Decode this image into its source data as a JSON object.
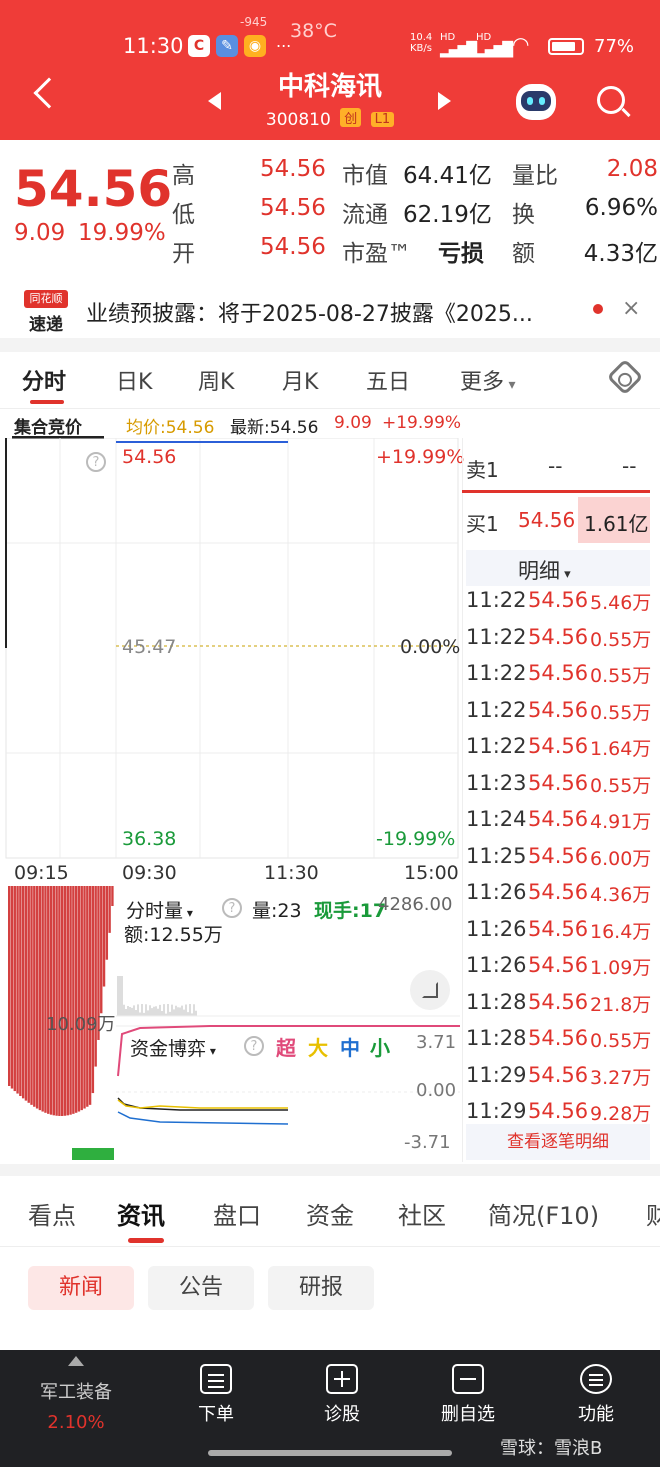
{
  "status_bar": {
    "time": "11:30",
    "temp": "38°C",
    "tiny_num": "-945",
    "more": "...",
    "net": "10.4\nKB/s",
    "net_label": "HD",
    "battery": "77%"
  },
  "header": {
    "title": "中科海讯",
    "code": "300810",
    "tag1": "创",
    "tag2": "L1"
  },
  "quote": {
    "price": "54.56",
    "change": "9.09",
    "change_pct": "19.99%",
    "high_label": "高",
    "high": "54.56",
    "low_label": "低",
    "low": "54.56",
    "open_label": "开",
    "open": "54.56",
    "mcap_label": "市值",
    "mcap": "64.41亿",
    "float_label": "流通",
    "float": "62.19亿",
    "pe_label": "市盈™",
    "pe": "亏损",
    "vol_ratio_label": "量比",
    "vol_ratio": "2.08",
    "turnover_label": "换",
    "turnover": "6.96%",
    "amount_label": "额",
    "amount": "4.33亿"
  },
  "news": {
    "logo_top": "同花顺",
    "logo_bottom": "速递",
    "text": "业绩预披露：将于2025-08-27披露《2025...",
    "close": "×"
  },
  "chart_tabs": [
    "分时",
    "日K",
    "周K",
    "月K",
    "五日",
    "更多"
  ],
  "chart_info": {
    "auction": "集合竞价",
    "avg": "均价:54.56",
    "latest": "最新:54.56",
    "chg": "9.09",
    "pct": "+19.99%"
  },
  "chart_data": {
    "type": "line",
    "y_left_labels": [
      "54.56",
      "45.47",
      "36.38"
    ],
    "y_right_labels": [
      "+19.99%",
      "0.00%",
      "-19.99%"
    ],
    "x_labels": [
      "09:15",
      "09:30",
      "11:30",
      "15:00"
    ],
    "prev_close": 45.47,
    "price": 54.56,
    "ylim": [
      36.38,
      54.56
    ]
  },
  "volume_panel": {
    "label": "分时量",
    "vol": "量:23",
    "now": "现手:17",
    "right": "4286.00",
    "amount": "额:12.55万",
    "left_val": "10.09万"
  },
  "fund_panel": {
    "label": "资金博弈",
    "super": "超",
    "big": "大",
    "mid": "中",
    "small": "小",
    "top": "3.71",
    "zero": "0.00",
    "bottom": "-3.71"
  },
  "order_book": {
    "sell_label": "卖1",
    "sell_price": "--",
    "sell_vol": "--",
    "buy_label": "买1",
    "buy_price": "54.56",
    "buy_vol": "1.61亿"
  },
  "detail": {
    "title": "明细",
    "rows": [
      {
        "t": "11:22",
        "p": "54.56",
        "v": "5.46万"
      },
      {
        "t": "11:22",
        "p": "54.56",
        "v": "0.55万"
      },
      {
        "t": "11:22",
        "p": "54.56",
        "v": "0.55万"
      },
      {
        "t": "11:22",
        "p": "54.56",
        "v": "0.55万"
      },
      {
        "t": "11:22",
        "p": "54.56",
        "v": "1.64万"
      },
      {
        "t": "11:23",
        "p": "54.56",
        "v": "0.55万"
      },
      {
        "t": "11:24",
        "p": "54.56",
        "v": "4.91万"
      },
      {
        "t": "11:25",
        "p": "54.56",
        "v": "6.00万"
      },
      {
        "t": "11:26",
        "p": "54.56",
        "v": "4.36万"
      },
      {
        "t": "11:26",
        "p": "54.56",
        "v": "16.4万"
      },
      {
        "t": "11:26",
        "p": "54.56",
        "v": "1.09万"
      },
      {
        "t": "11:28",
        "p": "54.56",
        "v": "21.8万"
      },
      {
        "t": "11:28",
        "p": "54.56",
        "v": "0.55万"
      },
      {
        "t": "11:29",
        "p": "54.56",
        "v": "3.27万"
      },
      {
        "t": "11:29",
        "p": "54.56",
        "v": "9.28万"
      }
    ],
    "more_link": "查看逐笔明细"
  },
  "bottom_tabs": [
    "看点",
    "资讯",
    "盘口",
    "资金",
    "社区",
    "简况(F10)",
    "财"
  ],
  "sub_tabs": [
    "新闻",
    "公告",
    "研报"
  ],
  "footer": {
    "sector": "军工装备",
    "sector_pct": "2.10%",
    "items": [
      "下单",
      "诊股",
      "删自选",
      "功能"
    ],
    "watermark": "雪球：雪浪B"
  },
  "colors": {
    "red": "#e0332c",
    "green": "#1a9a3a",
    "header": "#ef3c38",
    "footer": "#202124"
  }
}
